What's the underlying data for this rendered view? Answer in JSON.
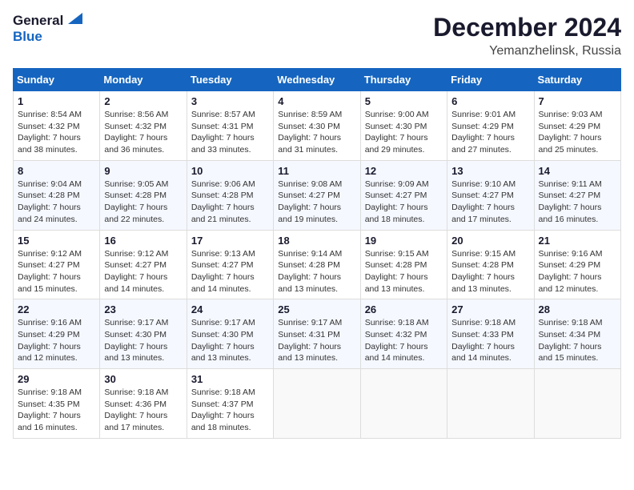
{
  "header": {
    "logo_line1": "General",
    "logo_line2": "Blue",
    "month_year": "December 2024",
    "location": "Yemanzhelinsk, Russia"
  },
  "weekdays": [
    "Sunday",
    "Monday",
    "Tuesday",
    "Wednesday",
    "Thursday",
    "Friday",
    "Saturday"
  ],
  "weeks": [
    [
      {
        "day": "1",
        "info": "Sunrise: 8:54 AM\nSunset: 4:32 PM\nDaylight: 7 hours\nand 38 minutes."
      },
      {
        "day": "2",
        "info": "Sunrise: 8:56 AM\nSunset: 4:32 PM\nDaylight: 7 hours\nand 36 minutes."
      },
      {
        "day": "3",
        "info": "Sunrise: 8:57 AM\nSunset: 4:31 PM\nDaylight: 7 hours\nand 33 minutes."
      },
      {
        "day": "4",
        "info": "Sunrise: 8:59 AM\nSunset: 4:30 PM\nDaylight: 7 hours\nand 31 minutes."
      },
      {
        "day": "5",
        "info": "Sunrise: 9:00 AM\nSunset: 4:30 PM\nDaylight: 7 hours\nand 29 minutes."
      },
      {
        "day": "6",
        "info": "Sunrise: 9:01 AM\nSunset: 4:29 PM\nDaylight: 7 hours\nand 27 minutes."
      },
      {
        "day": "7",
        "info": "Sunrise: 9:03 AM\nSunset: 4:29 PM\nDaylight: 7 hours\nand 25 minutes."
      }
    ],
    [
      {
        "day": "8",
        "info": "Sunrise: 9:04 AM\nSunset: 4:28 PM\nDaylight: 7 hours\nand 24 minutes."
      },
      {
        "day": "9",
        "info": "Sunrise: 9:05 AM\nSunset: 4:28 PM\nDaylight: 7 hours\nand 22 minutes."
      },
      {
        "day": "10",
        "info": "Sunrise: 9:06 AM\nSunset: 4:28 PM\nDaylight: 7 hours\nand 21 minutes."
      },
      {
        "day": "11",
        "info": "Sunrise: 9:08 AM\nSunset: 4:27 PM\nDaylight: 7 hours\nand 19 minutes."
      },
      {
        "day": "12",
        "info": "Sunrise: 9:09 AM\nSunset: 4:27 PM\nDaylight: 7 hours\nand 18 minutes."
      },
      {
        "day": "13",
        "info": "Sunrise: 9:10 AM\nSunset: 4:27 PM\nDaylight: 7 hours\nand 17 minutes."
      },
      {
        "day": "14",
        "info": "Sunrise: 9:11 AM\nSunset: 4:27 PM\nDaylight: 7 hours\nand 16 minutes."
      }
    ],
    [
      {
        "day": "15",
        "info": "Sunrise: 9:12 AM\nSunset: 4:27 PM\nDaylight: 7 hours\nand 15 minutes."
      },
      {
        "day": "16",
        "info": "Sunrise: 9:12 AM\nSunset: 4:27 PM\nDaylight: 7 hours\nand 14 minutes."
      },
      {
        "day": "17",
        "info": "Sunrise: 9:13 AM\nSunset: 4:27 PM\nDaylight: 7 hours\nand 14 minutes."
      },
      {
        "day": "18",
        "info": "Sunrise: 9:14 AM\nSunset: 4:28 PM\nDaylight: 7 hours\nand 13 minutes."
      },
      {
        "day": "19",
        "info": "Sunrise: 9:15 AM\nSunset: 4:28 PM\nDaylight: 7 hours\nand 13 minutes."
      },
      {
        "day": "20",
        "info": "Sunrise: 9:15 AM\nSunset: 4:28 PM\nDaylight: 7 hours\nand 13 minutes."
      },
      {
        "day": "21",
        "info": "Sunrise: 9:16 AM\nSunset: 4:29 PM\nDaylight: 7 hours\nand 12 minutes."
      }
    ],
    [
      {
        "day": "22",
        "info": "Sunrise: 9:16 AM\nSunset: 4:29 PM\nDaylight: 7 hours\nand 12 minutes."
      },
      {
        "day": "23",
        "info": "Sunrise: 9:17 AM\nSunset: 4:30 PM\nDaylight: 7 hours\nand 13 minutes."
      },
      {
        "day": "24",
        "info": "Sunrise: 9:17 AM\nSunset: 4:30 PM\nDaylight: 7 hours\nand 13 minutes."
      },
      {
        "day": "25",
        "info": "Sunrise: 9:17 AM\nSunset: 4:31 PM\nDaylight: 7 hours\nand 13 minutes."
      },
      {
        "day": "26",
        "info": "Sunrise: 9:18 AM\nSunset: 4:32 PM\nDaylight: 7 hours\nand 14 minutes."
      },
      {
        "day": "27",
        "info": "Sunrise: 9:18 AM\nSunset: 4:33 PM\nDaylight: 7 hours\nand 14 minutes."
      },
      {
        "day": "28",
        "info": "Sunrise: 9:18 AM\nSunset: 4:34 PM\nDaylight: 7 hours\nand 15 minutes."
      }
    ],
    [
      {
        "day": "29",
        "info": "Sunrise: 9:18 AM\nSunset: 4:35 PM\nDaylight: 7 hours\nand 16 minutes."
      },
      {
        "day": "30",
        "info": "Sunrise: 9:18 AM\nSunset: 4:36 PM\nDaylight: 7 hours\nand 17 minutes."
      },
      {
        "day": "31",
        "info": "Sunrise: 9:18 AM\nSunset: 4:37 PM\nDaylight: 7 hours\nand 18 minutes."
      },
      {
        "day": "",
        "info": ""
      },
      {
        "day": "",
        "info": ""
      },
      {
        "day": "",
        "info": ""
      },
      {
        "day": "",
        "info": ""
      }
    ]
  ]
}
